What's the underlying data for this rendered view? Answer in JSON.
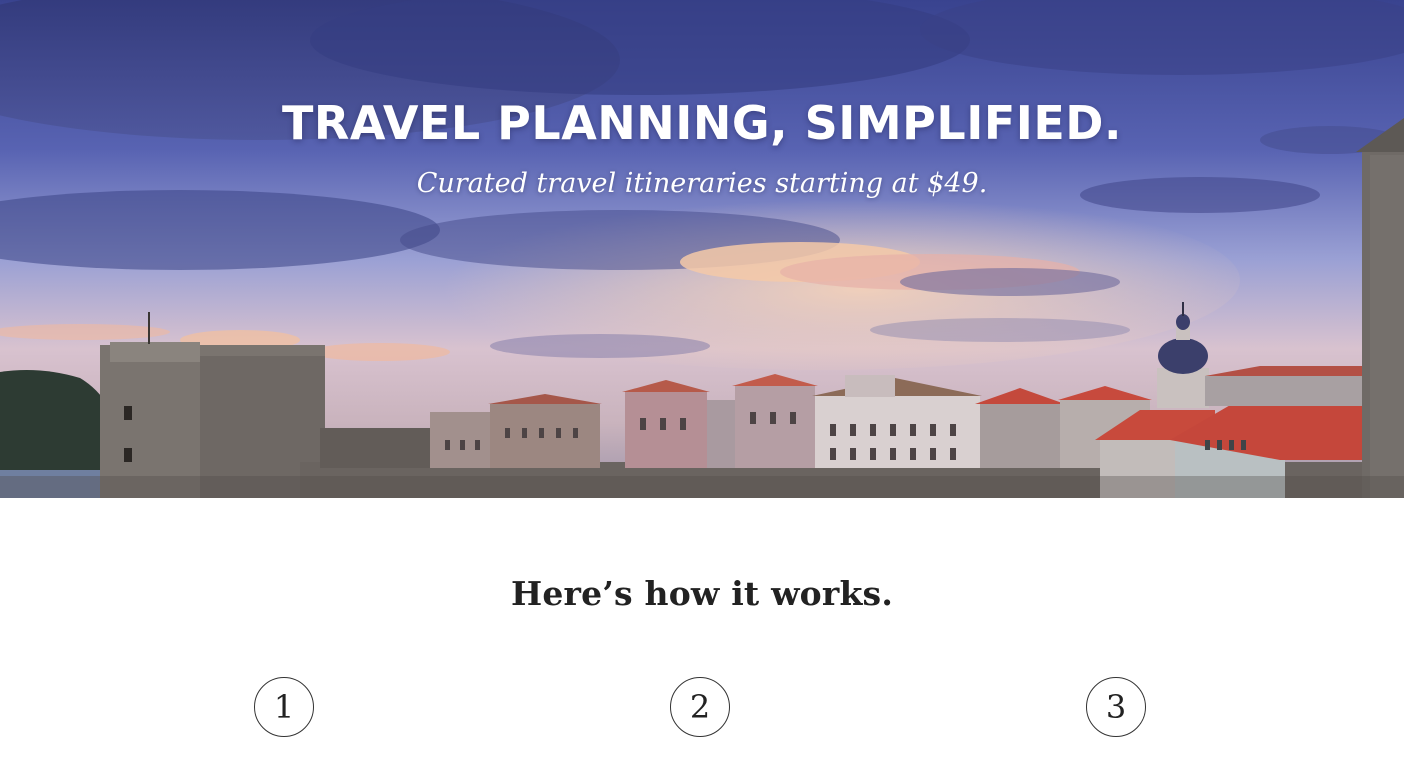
{
  "hero": {
    "title": "TRAVEL PLANNING, SIMPLIFIED.",
    "subtitle": "Curated travel itineraries starting at $49."
  },
  "how_it_works": {
    "heading": "Here’s how it works.",
    "steps": [
      {
        "number": "1"
      },
      {
        "number": "2"
      },
      {
        "number": "3"
      }
    ]
  },
  "colors": {
    "sky_top": "#3d4a9c",
    "sky_mid": "#7b86c9",
    "sky_horizon": "#e8c6c4",
    "roof_red": "#c8463a",
    "stone": "#8a8580",
    "text_dark": "#222222"
  }
}
